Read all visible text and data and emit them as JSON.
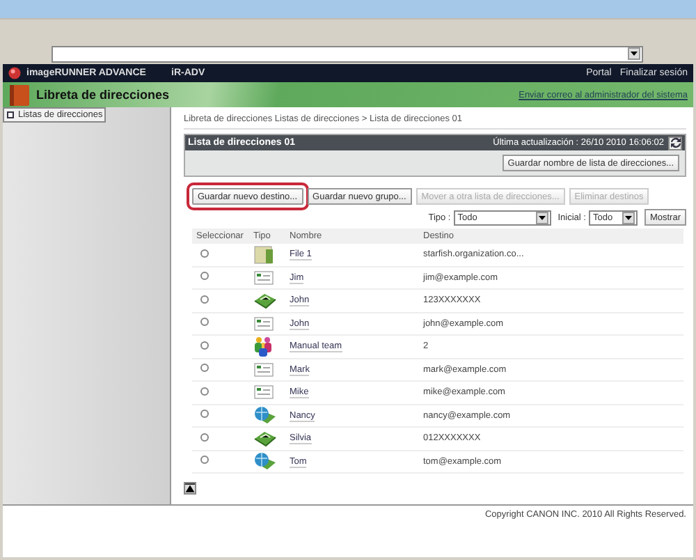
{
  "header": {
    "product": "imageRUNNER ADVANCE",
    "device": "iR-ADV",
    "links": [
      "Portal",
      "Finalizar sesión"
    ]
  },
  "banner": {
    "title": "Libreta de direcciones",
    "link": "Enviar correo al administrador del sistema"
  },
  "sidebar": {
    "items": [
      {
        "label": "Listas de direcciones",
        "selected": true
      }
    ]
  },
  "breadcrumb": "Libreta de direcciones  Listas de direcciones > Lista de direcciones 01",
  "panel": {
    "title": "Lista de direcciones 01",
    "updated": "Última actualización : 26/10 2010 16:06:02",
    "save_name_button": "Guardar nombre de lista de direcciones..."
  },
  "actions": [
    {
      "label": "Guardar nuevo destino...",
      "disabled": false,
      "highlighted": true
    },
    {
      "label": "Guardar nuevo grupo...",
      "disabled": false,
      "highlighted": false
    },
    {
      "label": "Mover a otra lista de direcciones...",
      "disabled": true,
      "highlighted": false
    },
    {
      "label": "Eliminar destinos",
      "disabled": true,
      "highlighted": false
    }
  ],
  "filters": {
    "type_label": "Tipo :",
    "type_value": "Todo",
    "initial_label": "Inicial :",
    "initial_value": "Todo",
    "show_button": "Mostrar"
  },
  "table": {
    "columns": [
      "Seleccionar",
      "Tipo",
      "Nombre",
      "Destino"
    ],
    "rows": [
      {
        "kind": "file",
        "name": "File 1",
        "destination": "starfish.organization.co...",
        "selected": false
      },
      {
        "kind": "email",
        "name": "Jim",
        "destination": "jim@example.com",
        "selected": false
      },
      {
        "kind": "fax",
        "name": "John",
        "destination": "123XXXXXXX",
        "selected": false
      },
      {
        "kind": "email",
        "name": "John",
        "destination": "john@example.com",
        "selected": false
      },
      {
        "kind": "group",
        "name": "Manual team",
        "destination": "2",
        "selected": false
      },
      {
        "kind": "email",
        "name": "Mark",
        "destination": "mark@example.com",
        "selected": false
      },
      {
        "kind": "email",
        "name": "Mike",
        "destination": "mike@example.com",
        "selected": false
      },
      {
        "kind": "ifax",
        "name": "Nancy",
        "destination": "nancy@example.com",
        "selected": false
      },
      {
        "kind": "fax",
        "name": "Silvia",
        "destination": "012XXXXXXX",
        "selected": false
      },
      {
        "kind": "ifax",
        "name": "Tom",
        "destination": "tom@example.com",
        "selected": false
      }
    ]
  },
  "footer": "Copyright CANON INC. 2010 All Rights Reserved."
}
